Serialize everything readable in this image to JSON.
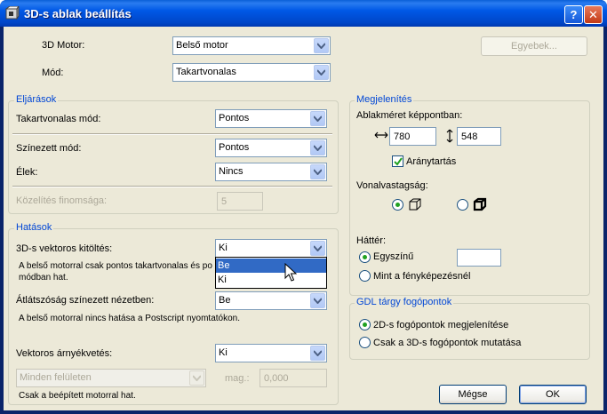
{
  "window": {
    "title": "3D-s ablak beállítás",
    "help_label": "?",
    "close_label": "✕"
  },
  "top": {
    "engine_label": "3D Motor:",
    "engine_value": "Belső motor",
    "mode_label": "Mód:",
    "mode_value": "Takartvonalas",
    "other_button": "Egyebek..."
  },
  "procedures": {
    "title": "Eljárások",
    "hidden_mode_label": "Takartvonalas mód:",
    "hidden_mode_value": "Pontos",
    "shaded_mode_label": "Színezett mód:",
    "shaded_mode_value": "Pontos",
    "edges_label": "Élek:",
    "edges_value": "Nincs",
    "approx_label": "Közelítés finomsága:",
    "approx_value": "5"
  },
  "effects": {
    "title": "Hatások",
    "vector_fill_label": "3D-s vektoros kitöltés:",
    "vector_fill_value": "Ki",
    "vector_fill_note_1": "A belső motorral csak pontos takartvonalas és po",
    "vector_fill_note_2": "módban hat.",
    "transparency_label": "Átlátszóság színezett nézetben:",
    "transparency_value": "Be",
    "transparency_note": "A belső motorral nincs hatása a Postscript nyomtatókon.",
    "shadow_label": "Vektoros árnyékvetés:",
    "shadow_value": "Ki",
    "surfaces_value": "Minden felületen",
    "height_label": "mag.:",
    "height_value": "0,000",
    "builtin_note": "Csak a beépített motorral hat."
  },
  "dropdown": {
    "items": [
      "Be",
      "Ki"
    ],
    "selected": "Be"
  },
  "display": {
    "title": "Megjelenítés",
    "window_size_label": "Ablakméret képpontban:",
    "width_value": "780",
    "height_value": "548",
    "ratio_label": "Aránytartás",
    "ratio_checked": true,
    "line_weight_label": "Vonalvastagság:",
    "background_label": "Háttér:",
    "solid_label": "Egyszínű",
    "photo_label": "Mint a fényképezésnél"
  },
  "gdl": {
    "title": "GDL tárgy fogópontok",
    "show2d_label": "2D-s fogópontok megjelenítése",
    "only3d_label": "Csak a 3D-s fogópontok mutatása"
  },
  "buttons": {
    "cancel": "Mégse",
    "ok": "OK"
  },
  "colors": {
    "accent": "#0046d5",
    "titlebar": "#0058e6",
    "dialog_bg": "#ece9d8",
    "selection": "#316ac5"
  }
}
